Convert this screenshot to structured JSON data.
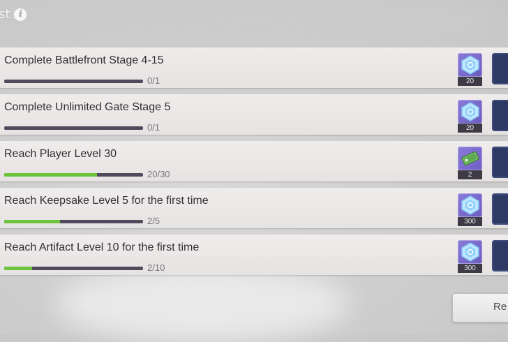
{
  "header": {
    "title_fragment": "st",
    "info_icon": "i"
  },
  "quests": [
    {
      "title": "Complete Battlefront Stage 4-15",
      "progress_text": "0/1",
      "progress": 0.0,
      "reward_icon": "blue-hex-gem-icon",
      "reward_count": "20"
    },
    {
      "title": "Complete Unlimited Gate Stage 5",
      "progress_text": "0/1",
      "progress": 0.0,
      "reward_icon": "blue-hex-gem-icon",
      "reward_count": "20"
    },
    {
      "title": "Reach Player Level 30",
      "progress_text": "20/30",
      "progress": 0.667,
      "reward_icon": "green-ticket-icon",
      "reward_count": "2"
    },
    {
      "title": "Reach Keepsake Level 5 for the first time",
      "progress_text": "2/5",
      "progress": 0.4,
      "reward_icon": "blue-hex-gem-icon",
      "reward_count": "300"
    },
    {
      "title": "Reach Artifact Level 10 for the first time",
      "progress_text": "2/10",
      "progress": 0.2,
      "reward_icon": "blue-hex-gem-icon",
      "reward_count": "300"
    }
  ],
  "bottom_button": {
    "label": "Re"
  },
  "colors": {
    "progress_fill": "#6cc43a",
    "progress_track": "#4f4b5c",
    "reward_bg": "#7a6bcd",
    "claim_button": "#2d3a63"
  }
}
